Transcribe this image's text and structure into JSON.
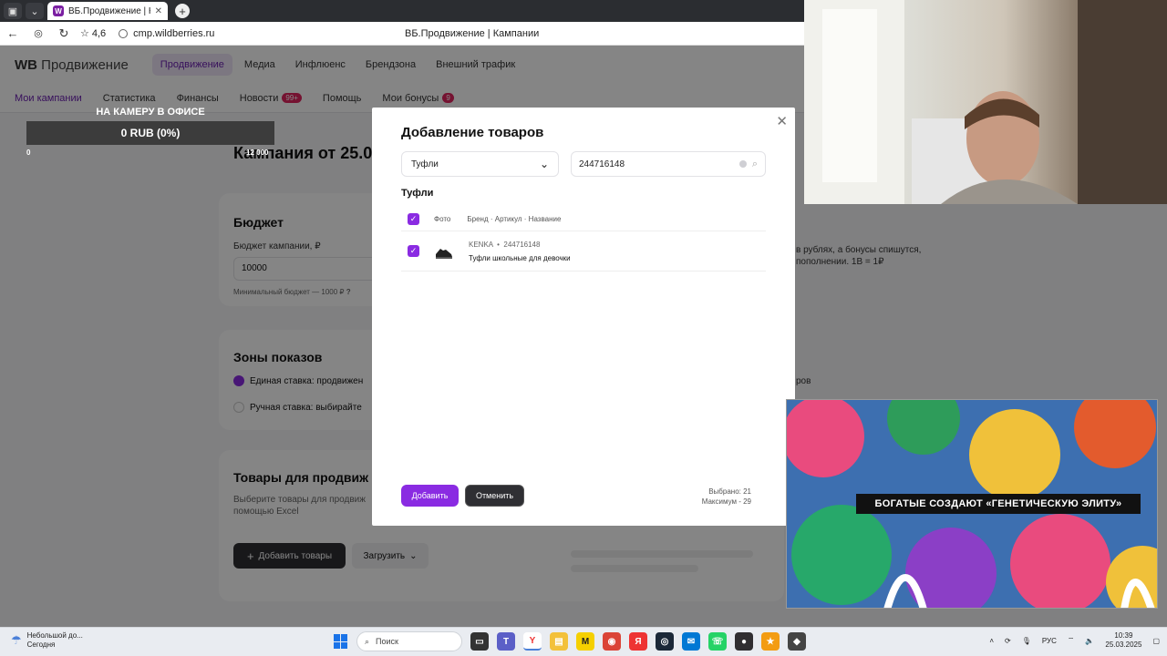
{
  "browser": {
    "tab_title": "ВБ.Продвижение | Кам",
    "rating": "4,6",
    "url": "cmp.wildberries.ru",
    "page_title": "ВБ.Продвижение | Кампании"
  },
  "nav": {
    "logo_wb": "WB",
    "logo_text": "Продвижение",
    "items": [
      "Продвижение",
      "Медиа",
      "Инфлюенс",
      "Брендзона",
      "Внешний трафик"
    ]
  },
  "subnav": {
    "items": [
      "Мои кампании",
      "Статистика",
      "Финансы",
      "Новости",
      "Помощь",
      "Мои бонусы"
    ],
    "news_badge": "99+",
    "bonus_badge": "9"
  },
  "stream": {
    "goal_label": "НА КАМЕРУ В ОФИСЕ",
    "goal_value": "0 RUB (0%)",
    "goal_min": "0",
    "goal_max": "12 000"
  },
  "campaign": {
    "title": "Кампания от 25.0",
    "budget": {
      "heading": "Бюджет",
      "field_label": "Бюджет кампании, ₽",
      "field_value": "10000",
      "min_note": "Минимальный бюджет — 1000 ₽",
      "hint_icon": "?",
      "right_note_1": "в рублях, а бонусы спишутся,",
      "right_note_2": "пополнении. 1В = 1₽"
    },
    "zones": {
      "heading": "Зоны показов",
      "option_1": "Единая ставка: продвижен",
      "option_2": "Ручная ставка: выбирайте",
      "right_note": "ров"
    },
    "products": {
      "heading": "Товары для продвиж",
      "desc_1": "Выберите товары для продвиж",
      "desc_2": "помощью Excel",
      "add_button": "Добавить товары",
      "upload_button": "Загрузить"
    }
  },
  "modal": {
    "title": "Добавление товаров",
    "category_value": "Туфли",
    "search_value": "244716148",
    "section_title": "Туфли",
    "header_photo": "Фото",
    "header_desc": "Бренд · Артикул · Название",
    "rows": [
      {
        "brand": "KENKA",
        "sku": "244716148",
        "name": "Туфли школьные для девочки"
      }
    ],
    "add_button": "Добавить",
    "cancel_button": "Отменить",
    "selected_text": "Выбрано: 21",
    "max_text": "Максимум - 29"
  },
  "video": {
    "caption": "БОГАТЫЕ СОЗДАЮТ «ГЕНЕТИЧЕСКУЮ ЭЛИТУ»"
  },
  "taskbar": {
    "weather_line1": "Небольшой до...",
    "weather_line2": "Сегодня",
    "search_placeholder": "Поиск",
    "lang": "РУС",
    "time": "10:39",
    "date": "25.03.2025"
  },
  "colors": {
    "accent": "#8a2be2",
    "nav_active_bg": "#ede5f7",
    "badge": "#e0245e"
  }
}
